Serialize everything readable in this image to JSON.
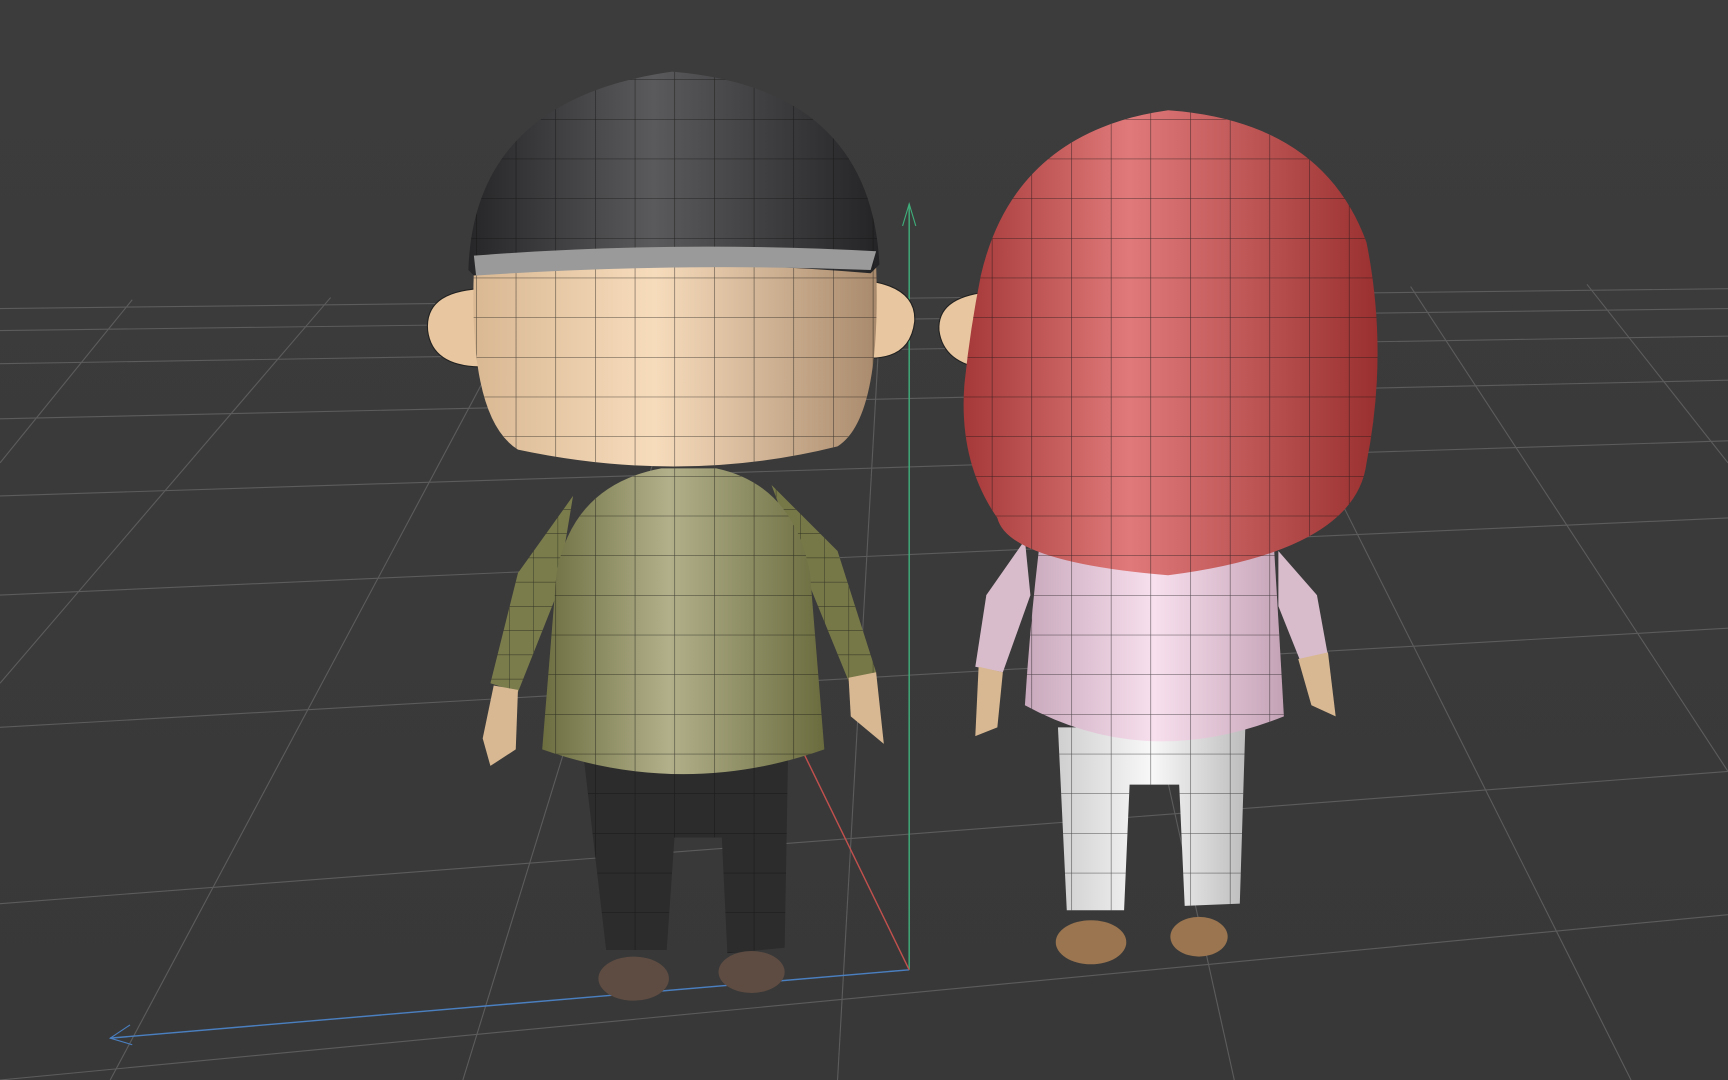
{
  "viewport": {
    "name": "3d-viewport",
    "background": "#3a3a3a",
    "grid_color": "#5a5a5a",
    "axis_colors": {
      "x": "#c0504d",
      "y": "#3fae7a",
      "z": "#4a7fc0"
    }
  },
  "scene": {
    "objects": [
      {
        "name": "boy-character",
        "colors": {
          "hat": "#2e2e30",
          "skin": "#e8c7a0",
          "shirt": "#8a8c58",
          "pants": "#2a2a2a",
          "shoes": "#5a4a40"
        }
      },
      {
        "name": "girl-character",
        "colors": {
          "hair": "#c84a4a",
          "skin": "#e8c7a0",
          "shirt": "#e8c8dc",
          "pants": "#e8e8e8",
          "shoes": "#9a7550"
        }
      }
    ]
  }
}
